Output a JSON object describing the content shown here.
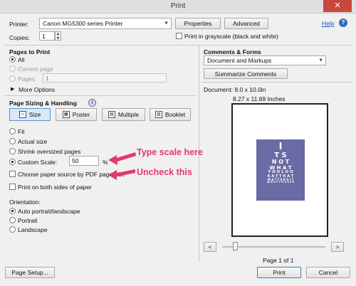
{
  "window": {
    "title": "Print",
    "close": "✕"
  },
  "printer": {
    "label": "Printer:",
    "selected": "Canon MG5300 series Printer",
    "properties": "Properties",
    "advanced": "Advanced",
    "help": "Help"
  },
  "copies": {
    "label": "Copies:",
    "value": "1"
  },
  "grayscale": {
    "label": "Print in grayscale (black and white)"
  },
  "pages_to_print": {
    "title": "Pages to Print",
    "all": "All",
    "current": "Current page",
    "pages": "Pages",
    "pages_value": "1",
    "more": "More Options"
  },
  "comments": {
    "title": "Comments & Forms",
    "selected": "Document and Markups",
    "summarize": "Summarize Comments"
  },
  "sizing": {
    "title": "Page Sizing & Handling",
    "info": "i",
    "modes": [
      "Size",
      "Poster",
      "Multiple",
      "Booklet"
    ],
    "fit": "Fit",
    "actual": "Actual size",
    "shrink": "Shrink oversized pages",
    "custom": "Custom Scale:",
    "scale_value": "50",
    "percent": "%",
    "source": "Choose paper source by PDF page size",
    "both_sides": "Print on both sides of paper"
  },
  "orientation": {
    "title": "Orientation:",
    "auto": "Auto portrait/landscape",
    "portrait": "Portrait",
    "landscape": "Landscape"
  },
  "annotations": {
    "scale": "Type scale here",
    "uncheck": "Uncheck this"
  },
  "preview": {
    "document": "Document: 8.0 x 10.0in",
    "paper": "8.27 x 11.69 Inches",
    "page_counter": "Page 1 of 1",
    "prev": "<",
    "next": ">",
    "poster_lines": [
      "I",
      "T S",
      "N O T",
      "W H A T",
      "Y O U L O O",
      "K A T T H A T",
      "M A T T E R S I T",
      "W H A T Y O U S E E"
    ]
  },
  "footer": {
    "page_setup": "Page Setup...",
    "print": "Print",
    "cancel": "Cancel"
  },
  "colors": {
    "accent": "#3c7fb1",
    "annotation": "#e03a6a",
    "poster": "#6a6aa4"
  }
}
